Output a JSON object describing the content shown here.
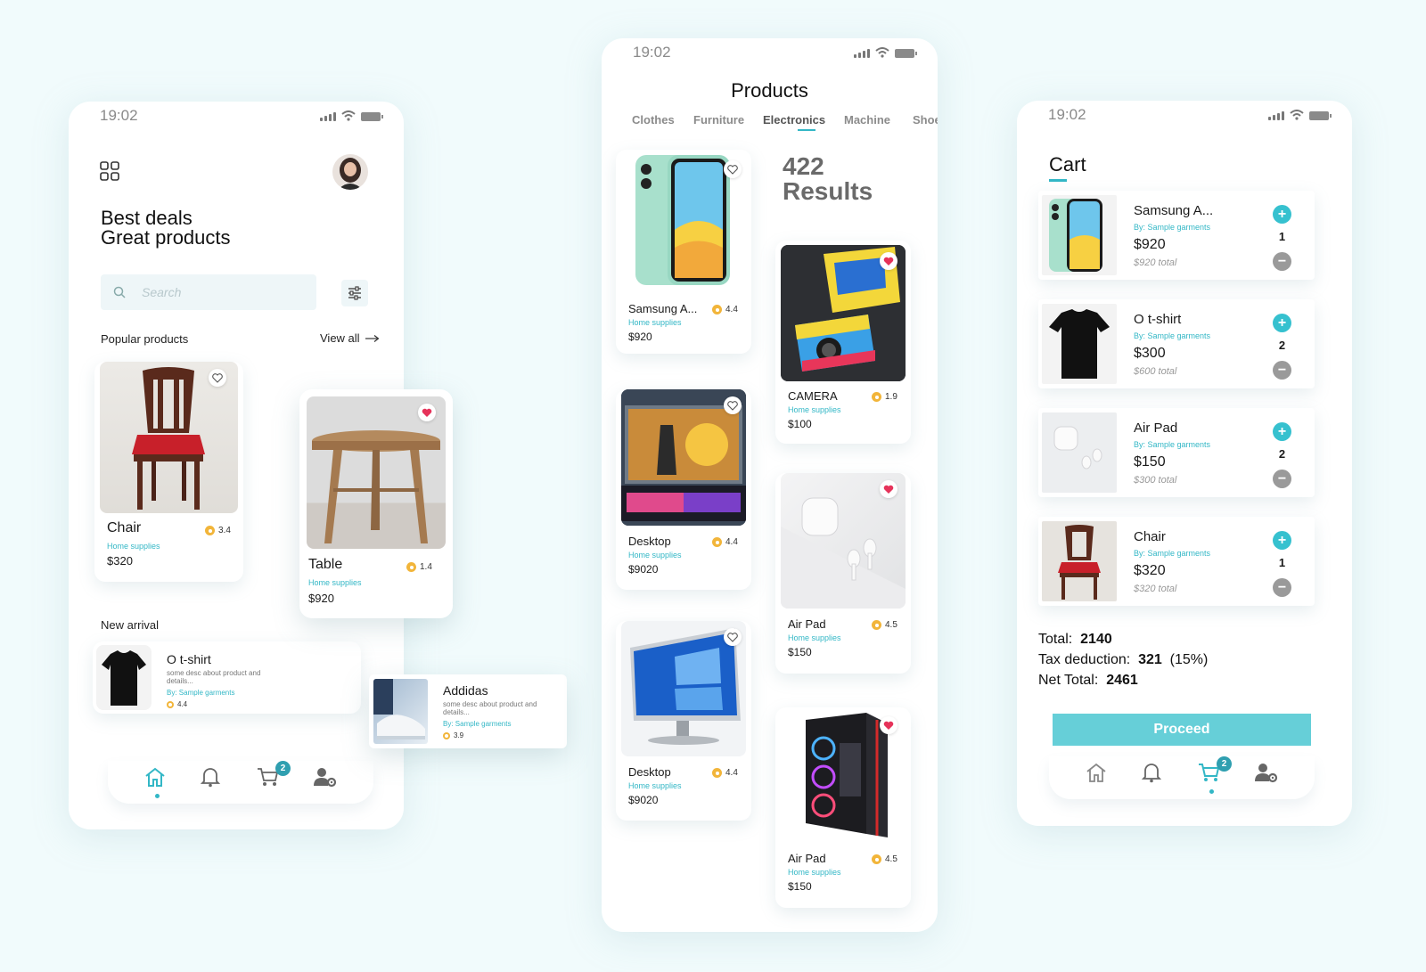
{
  "status_time": "19:02",
  "home": {
    "headline_1": "Best deals",
    "headline_2": "Great products",
    "search_placeholder": "Search",
    "popular_label": "Popular products",
    "view_all": "View all",
    "popular": [
      {
        "name": "Chair",
        "category": "Home supplies",
        "price": "$320",
        "rating": "3.4"
      },
      {
        "name": "Table",
        "category": "Home supplies",
        "price": "$920",
        "rating": "1.4"
      }
    ],
    "new_arrival_label": "New arrival",
    "new_arrivals": [
      {
        "name": "O t-shirt",
        "desc": "some desc about product and details...",
        "by": "By: Sample garments",
        "rating": "4.4"
      },
      {
        "name": "Addidas",
        "desc": "some desc about product and details...",
        "by": "By: Sample garments",
        "rating": "3.9"
      }
    ],
    "cart_badge": "2"
  },
  "products": {
    "title": "Products",
    "tabs": [
      "Clothes",
      "Furniture",
      "Electronics",
      "Machine",
      "Shoe"
    ],
    "active_tab": "Electronics",
    "results_count": "422",
    "results_label": "Results",
    "left_items": [
      {
        "name": "Samsung A...",
        "category": "Home supplies",
        "price": "$920",
        "rating": "4.4"
      },
      {
        "name": "Desktop",
        "category": "Home supplies",
        "price": "$9020",
        "rating": "4.4"
      },
      {
        "name": "Desktop",
        "category": "Home supplies",
        "price": "$9020",
        "rating": "4.4"
      }
    ],
    "right_items": [
      {
        "name": "CAMERA",
        "category": "Home supplies",
        "price": "$100",
        "rating": "1.9"
      },
      {
        "name": "Air Pad",
        "category": "Home supplies",
        "price": "$150",
        "rating": "4.5"
      },
      {
        "name": "Air Pad",
        "category": "Home supplies",
        "price": "$150",
        "rating": "4.5"
      }
    ]
  },
  "cart": {
    "title": "Cart",
    "items": [
      {
        "name": "Samsung A...",
        "by": "By: Sample garments",
        "price": "$920",
        "total": "$920 total",
        "qty": "1"
      },
      {
        "name": "O t-shirt",
        "by": "By: Sample garments",
        "price": "$300",
        "total": "$600 total",
        "qty": "2"
      },
      {
        "name": "Air Pad",
        "by": "By: Sample garments",
        "price": "$150",
        "total": "$300 total",
        "qty": "2"
      },
      {
        "name": "Chair",
        "by": "By: Sample garments",
        "price": "$320",
        "total": "$320 total",
        "qty": "1"
      }
    ],
    "total_label": "Total:",
    "total_value": "2140",
    "tax_label": "Tax deduction:",
    "tax_value": "321",
    "tax_pct": "(15%)",
    "net_label": "Net Total:",
    "net_value": "2461",
    "proceed": "Proceed",
    "cart_badge": "2"
  },
  "colors": {
    "accent": "#33b7c6",
    "proceed": "#66cfd8",
    "heart": "#e6335a",
    "star": "#f2b53a"
  }
}
